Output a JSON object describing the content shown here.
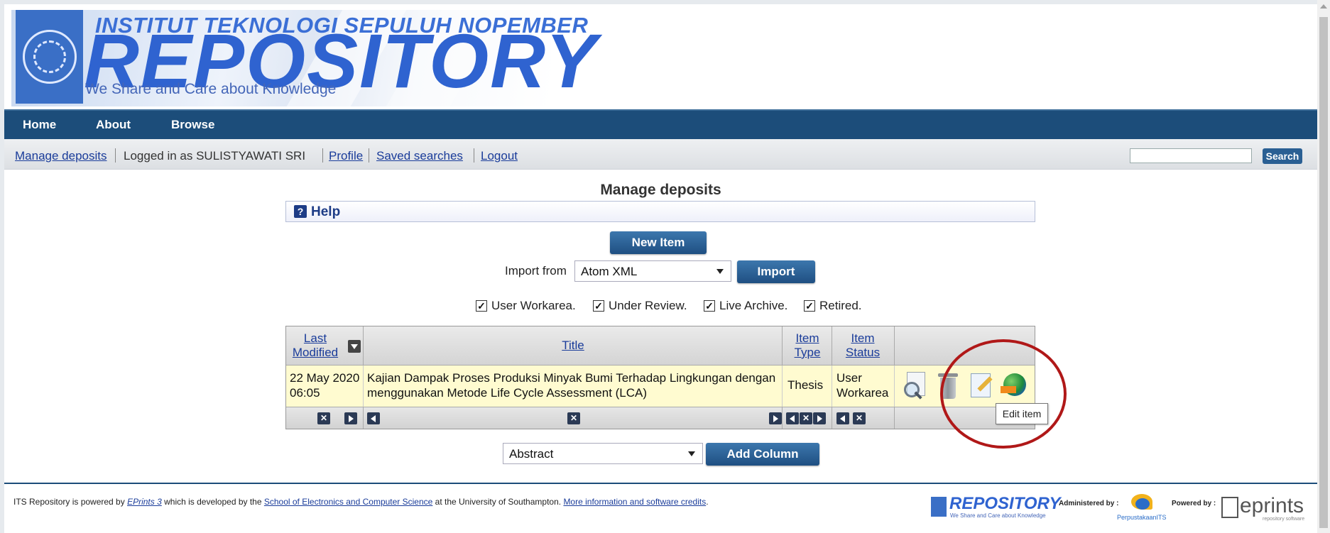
{
  "banner": {
    "institution": "INSTITUT TEKNOLOGI SEPULUH NOPEMBER",
    "repository": "REPOSITORY",
    "tagline": "We Share and Care about Knowledge"
  },
  "nav": {
    "items": [
      "Home",
      "About",
      "Browse"
    ]
  },
  "login_bar": {
    "manage_deposits": "Manage deposits",
    "logged_in_as": "Logged in as SULISTYAWATI SRI",
    "profile": "Profile",
    "saved_searches": "Saved searches",
    "logout": "Logout",
    "search_value": "",
    "search_button": "Search"
  },
  "page": {
    "title": "Manage deposits",
    "help": "Help",
    "new_item": "New Item",
    "import_from_label": "Import from",
    "import_format": "Atom XML",
    "import_button": "Import"
  },
  "filters": [
    {
      "label": "User Workarea.",
      "checked": true
    },
    {
      "label": "Under Review.",
      "checked": true
    },
    {
      "label": "Live Archive.",
      "checked": true
    },
    {
      "label": "Retired.",
      "checked": true
    }
  ],
  "table": {
    "columns": {
      "last_modified": "Last Modified",
      "title": "Title",
      "item_type": "Item Type",
      "item_status": "Item Status"
    },
    "rows": [
      {
        "last_modified": "22 May 2020 06:05",
        "title": "Kajian Dampak Proses Produksi Minyak Bumi Terhadap Lingkungan dengan menggunakan Metode Life Cycle Assessment (LCA)",
        "item_type": "Thesis",
        "item_status": "User Workarea",
        "actions": [
          "view-icon",
          "trash-icon",
          "edit-icon",
          "deposit-globe-icon"
        ]
      }
    ],
    "tooltip": "Edit item"
  },
  "add_column": {
    "selected": "Abstract",
    "button": "Add Column"
  },
  "footer": {
    "text_a": "ITS Repository is powered by ",
    "eprints_link": "EPrints 3",
    "text_b": " which is developed by the ",
    "school_link": "School of Electronics and Computer Science",
    "text_c": " at the University of Southampton. ",
    "credits_link": "More information and software credits",
    "text_d": ".",
    "logo_repository": "REPOSITORY",
    "logo_tagline": "We Share and Care about Knowledge",
    "administered_by": "Administered by :",
    "library": "PerpustakaanITS",
    "powered_by": "Powered by :",
    "eprints_logo": "eprints",
    "eprints_sub": "repository software"
  },
  "colors": {
    "nav_bg": "#1c4d7a",
    "link": "#1a3c9a",
    "row_bg": "#fffbd0",
    "annotation_circle": "#b01818"
  }
}
